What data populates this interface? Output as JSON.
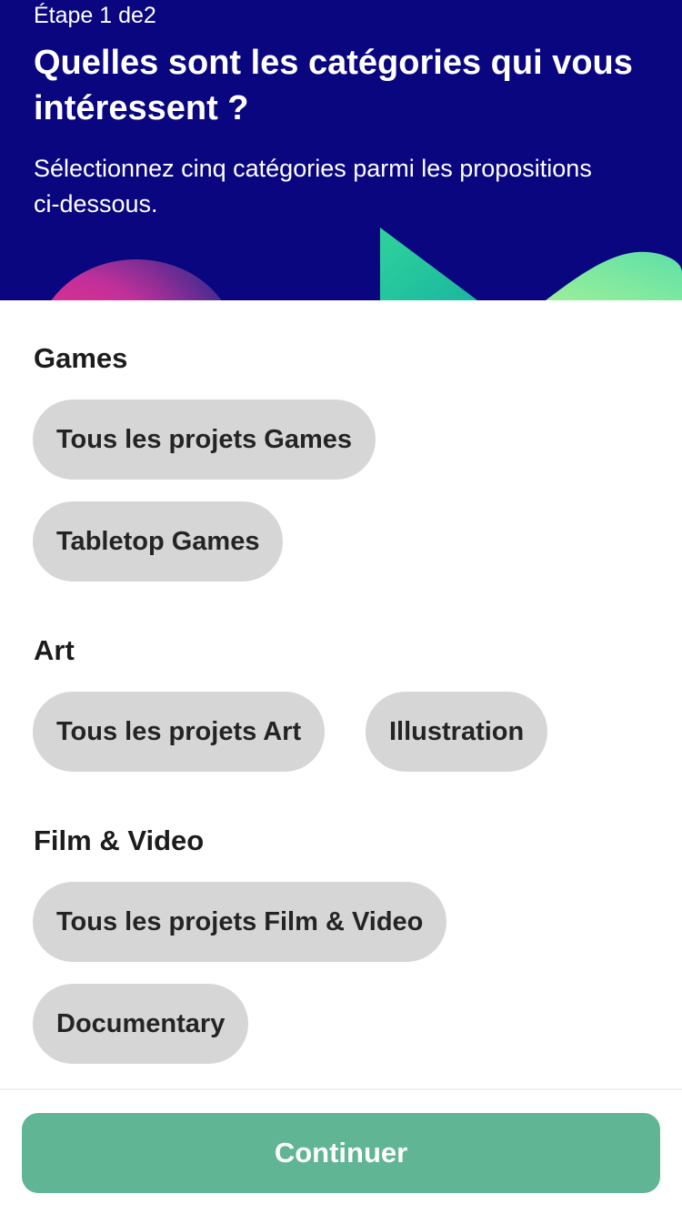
{
  "header": {
    "step": "Étape 1 de2",
    "title": "Quelles sont les catégories qui vous intéressent ?",
    "subtitle": "Sélectionnez cinq catégories parmi les propositions ci-dessous."
  },
  "sections": [
    {
      "heading": "Games",
      "chips": [
        "Tous les projets Games",
        "Tabletop Games"
      ]
    },
    {
      "heading": "Art",
      "chips": [
        "Tous les projets Art",
        "Illustration"
      ]
    },
    {
      "heading": "Film & Video",
      "chips": [
        "Tous les projets Film & Video",
        "Documentary"
      ]
    }
  ],
  "footer": {
    "continue_label": "Continuer"
  },
  "colors": {
    "header_bg": "#0a0680",
    "chip_bg": "#d6d6d6",
    "accent": "#5fb594"
  }
}
